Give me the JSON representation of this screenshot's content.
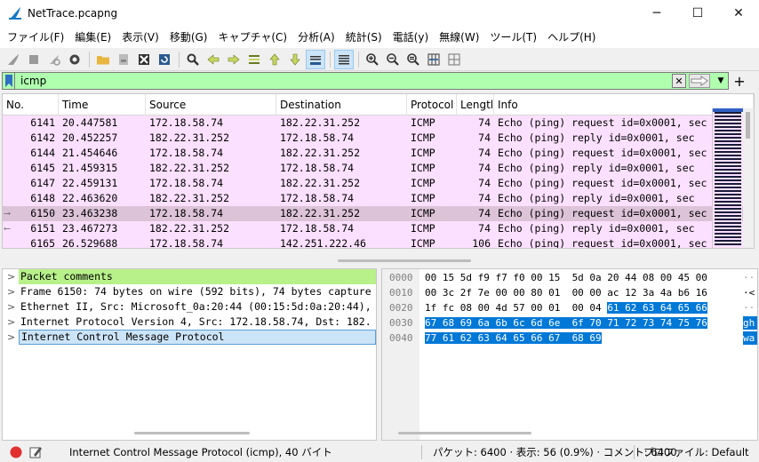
{
  "window": {
    "title": "NetTrace.pcapng",
    "minimize": "─",
    "maximize": "☐",
    "close": "✕"
  },
  "menu": [
    "ファイル(F)",
    "編集(E)",
    "表示(V)",
    "移動(G)",
    "キャプチャ(C)",
    "分析(A)",
    "統計(S)",
    "電話(y)",
    "無線(W)",
    "ツール(T)",
    "ヘルプ(H)"
  ],
  "filter": {
    "value": "icmp",
    "background": "#afffaf"
  },
  "packet_list": {
    "columns": [
      "No.",
      "Time",
      "Source",
      "Destination",
      "Protocol",
      "Lengtl",
      "Info"
    ],
    "rows": [
      {
        "no": "6141",
        "time": "20.447581",
        "src": "172.18.58.74",
        "dst": "182.22.31.252",
        "proto": "ICMP",
        "len": "74",
        "info": "Echo (ping) request  id=0x0001, sec"
      },
      {
        "no": "6142",
        "time": "20.452257",
        "src": "182.22.31.252",
        "dst": "172.18.58.74",
        "proto": "ICMP",
        "len": "74",
        "info": "Echo (ping) reply    id=0x0001, sec"
      },
      {
        "no": "6144",
        "time": "21.454646",
        "src": "172.18.58.74",
        "dst": "182.22.31.252",
        "proto": "ICMP",
        "len": "74",
        "info": "Echo (ping) request  id=0x0001, sec"
      },
      {
        "no": "6145",
        "time": "21.459315",
        "src": "182.22.31.252",
        "dst": "172.18.58.74",
        "proto": "ICMP",
        "len": "74",
        "info": "Echo (ping) reply    id=0x0001, sec"
      },
      {
        "no": "6147",
        "time": "22.459131",
        "src": "172.18.58.74",
        "dst": "182.22.31.252",
        "proto": "ICMP",
        "len": "74",
        "info": "Echo (ping) request  id=0x0001, sec"
      },
      {
        "no": "6148",
        "time": "22.463620",
        "src": "182.22.31.252",
        "dst": "172.18.58.74",
        "proto": "ICMP",
        "len": "74",
        "info": "Echo (ping) reply    id=0x0001, sec"
      },
      {
        "no": "6150",
        "time": "23.463238",
        "src": "172.18.58.74",
        "dst": "182.22.31.252",
        "proto": "ICMP",
        "len": "74",
        "info": "Echo (ping) request  id=0x0001, sec"
      },
      {
        "no": "6151",
        "time": "23.467273",
        "src": "182.22.31.252",
        "dst": "172.18.58.74",
        "proto": "ICMP",
        "len": "74",
        "info": "Echo (ping) reply    id=0x0001, sec"
      },
      {
        "no": "6165",
        "time": "26.529688",
        "src": "172.18.58.74",
        "dst": "142.251.222.46",
        "proto": "ICMP",
        "len": "106",
        "info": "Echo (ping) request  id=0x0001, sec"
      }
    ],
    "row_color": "#fce0ff",
    "selected_color": "#dcc3d8"
  },
  "details": {
    "rows": [
      "Packet comments",
      "Frame 6150: 74 bytes on wire (592 bits), 74 bytes capture",
      "Ethernet II, Src: Microsoft_0a:20:44 (00:15:5d:0a:20:44),",
      "Internet Protocol Version 4, Src: 172.18.58.74, Dst: 182.",
      "Internet Control Message Protocol"
    ]
  },
  "bytes": {
    "offsets": [
      "0000",
      "0010",
      "0020",
      "0030",
      "0040"
    ],
    "lines": [
      {
        "normal": "00 15 5d f9 f7 f0 00 15  5d 0a 20 44 08 00 45 00",
        "hl": "",
        "ascii": "··"
      },
      {
        "normal": "00 3c 2f 7e 00 00 80 01  00 00 ac 12 3a 4a b6 16",
        "hl": "",
        "ascii": "·<"
      },
      {
        "normal": "1f fc 08 00 4d 57 00 01  00 04 ",
        "hl": "61 62 63 64 65 66",
        "ascii": "··"
      },
      {
        "normal": "",
        "hl": "67 68 69 6a 6b 6c 6d 6e  6f 70 71 72 73 74 75 76",
        "ascii": "gh"
      },
      {
        "normal": "",
        "hl": "77 61 62 63 64 65 66 67  68 69",
        "ascii": "wa"
      }
    ]
  },
  "status": {
    "text": "Internet Control Message Protocol (icmp), 40 バイト",
    "packets": "パケット: 6400 · 表示: 56 (0.9%) · コメント: 6400",
    "profile": "プロファイル: Default"
  }
}
